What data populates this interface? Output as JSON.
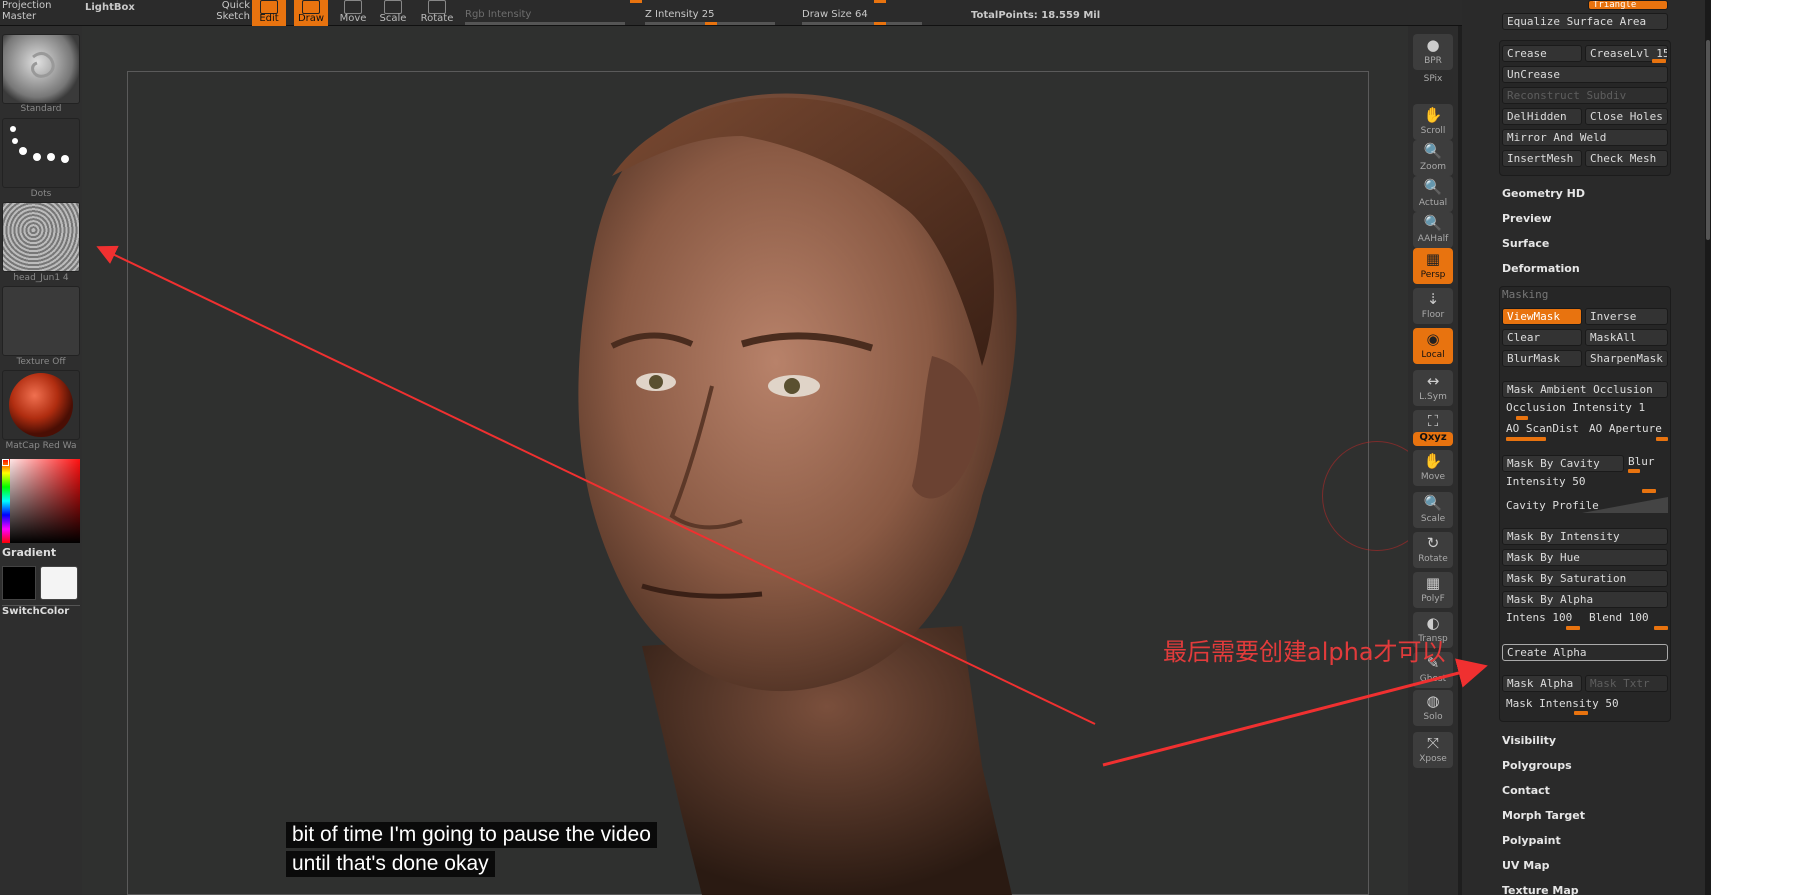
{
  "topbar": {
    "projection_master": "Projection\nMaster",
    "lightbox": "LightBox",
    "quick_sketch": "Quick\nSketch",
    "tools": [
      {
        "label": "Edit",
        "active": true
      },
      {
        "label": "Draw",
        "active": true
      },
      {
        "label": "Move",
        "active": false
      },
      {
        "label": "Scale",
        "active": false
      },
      {
        "label": "Rotate",
        "active": false
      }
    ],
    "rgb_intensity": "Rgb Intensity",
    "z_intensity": "Z Intensity 25",
    "draw_size": "Draw Size 64",
    "total_points": "TotalPoints: 18.559 Mil"
  },
  "left_shelf": {
    "brush_label": "Standard",
    "stroke_label": "Dots",
    "alpha_label": "head_Jun1 4",
    "texture_label": "Texture Off",
    "material_label": "MatCap Red Wa",
    "gradient_label": "Gradient",
    "switch_color_label": "SwitchColor"
  },
  "right_shelf": [
    {
      "label": "BPR",
      "glyph": "●",
      "active": false
    },
    {
      "label": "SPix",
      "glyph": "",
      "active": false
    },
    {
      "label": "Scroll",
      "glyph": "✋",
      "active": false
    },
    {
      "label": "Zoom",
      "glyph": "🔍",
      "active": false
    },
    {
      "label": "Actual",
      "glyph": "🔍",
      "active": false
    },
    {
      "label": "AAHalf",
      "glyph": "🔍",
      "active": false
    },
    {
      "label": "Persp",
      "glyph": "▦",
      "active": true
    },
    {
      "label": "Floor",
      "glyph": "⇣",
      "active": false
    },
    {
      "label": "Local",
      "glyph": "◉",
      "active": true
    },
    {
      "label": "L.Sym",
      "glyph": "↔",
      "active": false
    },
    {
      "label": "Frame",
      "glyph": "⛶",
      "active": false
    },
    {
      "label": "Move",
      "glyph": "✋",
      "active": false
    },
    {
      "label": "Scale",
      "glyph": "🔍",
      "active": false
    },
    {
      "label": "Rotate",
      "glyph": "↻",
      "active": false
    },
    {
      "label": "PolyF",
      "glyph": "▦",
      "active": false
    },
    {
      "label": "Transp",
      "glyph": "◐",
      "active": false
    },
    {
      "label": "Ghost",
      "glyph": "✎",
      "active": false
    },
    {
      "label": "Solo",
      "glyph": "◍",
      "active": false
    },
    {
      "label": "Xpose",
      "glyph": "⤧",
      "active": false
    }
  ],
  "xyz_label": "Qxyz",
  "palette": {
    "triangle_button": "Triangle",
    "equalize_surface_area": "Equalize Surface Area",
    "crease": "Crease",
    "crease_lvl": "CreaseLvl 15",
    "uncrease": "UnCrease",
    "reconstruct_subdiv": "Reconstruct Subdiv",
    "del_hidden": "DelHidden",
    "close_holes": "Close Holes",
    "mirror_and_weld": "Mirror And Weld",
    "insert_mesh": "InsertMesh",
    "check_mesh": "Check Mesh",
    "sections": {
      "geometry_hd": "Geometry HD",
      "preview": "Preview",
      "surface": "Surface",
      "deformation": "Deformation",
      "masking": "Masking",
      "visibility": "Visibility",
      "polygroups": "Polygroups",
      "contact": "Contact",
      "morph_target": "Morph Target",
      "polypaint": "Polypaint",
      "uv_map": "UV Map",
      "texture_map": "Texture Map"
    },
    "masking": {
      "view_mask": "ViewMask",
      "inverse": "Inverse",
      "clear": "Clear",
      "mask_all": "MaskAll",
      "blur_mask": "BlurMask",
      "sharpen_mask": "SharpenMask",
      "mask_ambient_occlusion": "Mask Ambient Occlusion",
      "occlusion_intensity": "Occlusion Intensity 1",
      "ao_scandist": "AO ScanDist",
      "ao_aperture": "AO Aperture",
      "mask_by_cavity": "Mask By Cavity",
      "blur": "Blur",
      "intensity": "Intensity 50",
      "cavity_profile": "Cavity Profile",
      "mask_by_intensity": "Mask By Intensity",
      "mask_by_hue": "Mask By Hue",
      "mask_by_saturation": "Mask By Saturation",
      "mask_by_alpha": "Mask By Alpha",
      "intens": "Intens 100",
      "blend": "Blend 100",
      "create_alpha": "Create Alpha",
      "mask_alpha": "Mask Alpha",
      "mask_txtr": "Mask Txtr",
      "mask_intensity": "Mask Intensity 50"
    }
  },
  "annotation_text": "最后需要创建alpha才可以",
  "subtitle": {
    "line1": "bit of time I'm going to pause the video",
    "line2": "until that's done okay"
  },
  "colors": {
    "accent": "#e8730f",
    "annotation": "#e23b3b"
  }
}
